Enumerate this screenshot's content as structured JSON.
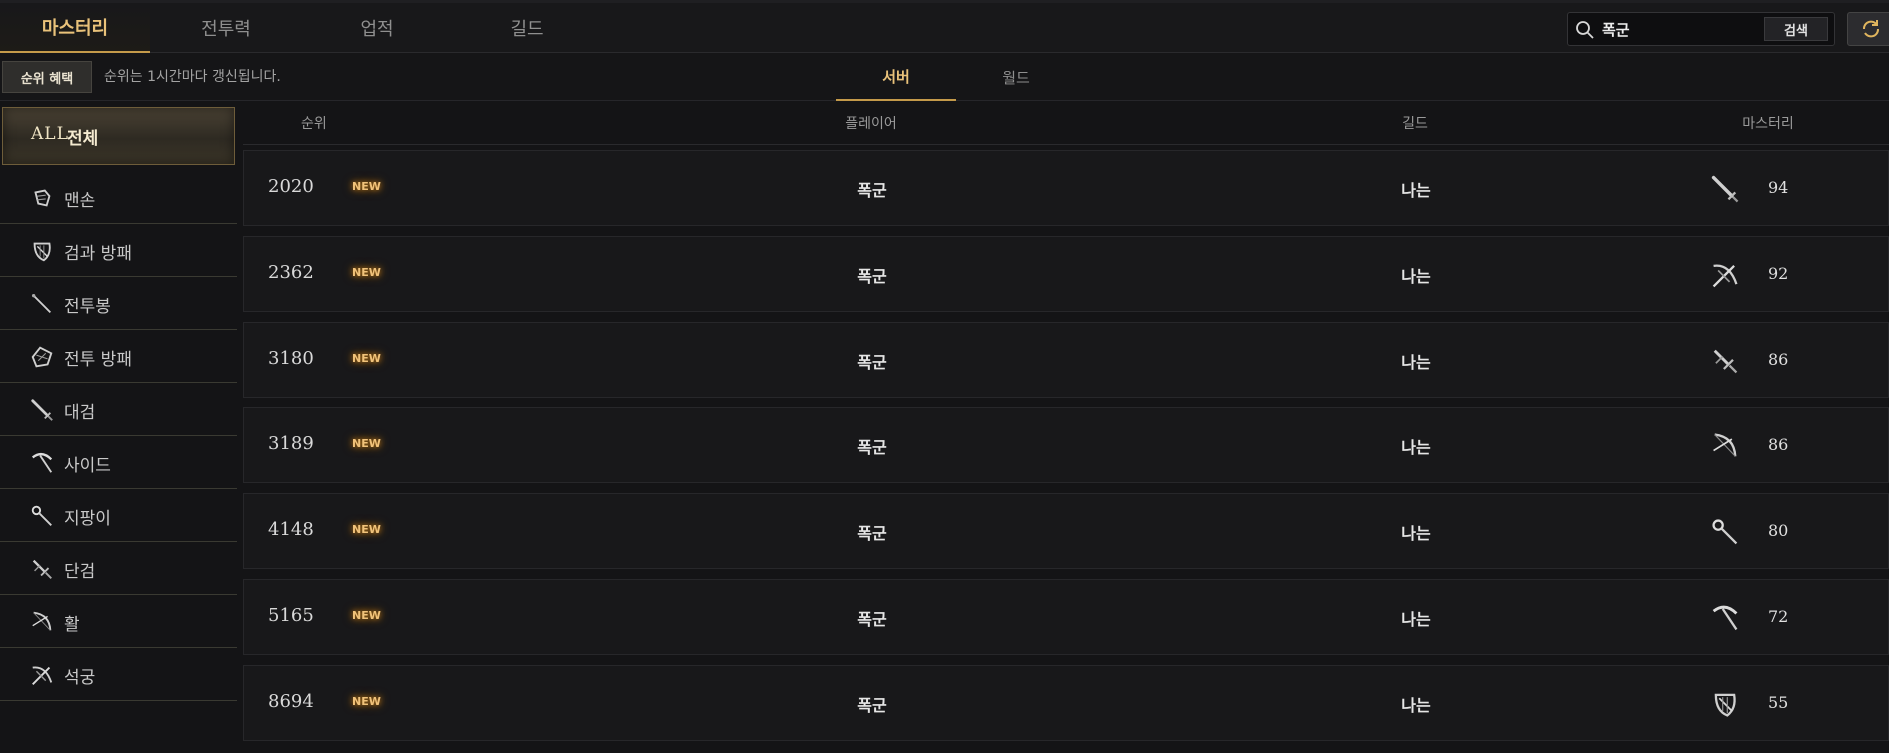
{
  "top_tabs": [
    {
      "label": "마스터리",
      "active": true
    },
    {
      "label": "전투력",
      "active": false
    },
    {
      "label": "업적",
      "active": false
    },
    {
      "label": "길드",
      "active": false
    }
  ],
  "search": {
    "value": "폭군",
    "button_label": "검색"
  },
  "subbar": {
    "benefit_label": "순위 혜택",
    "notice": "순위는 1시간마다 갱신됩니다.",
    "tabs": [
      {
        "label": "서버",
        "active": true
      },
      {
        "label": "월드",
        "active": false
      }
    ]
  },
  "sidebar": {
    "all_prefix": "ALL",
    "items": [
      {
        "label": "전체",
        "icon": "all-icon",
        "active": true
      },
      {
        "label": "맨손",
        "icon": "fist-icon"
      },
      {
        "label": "검과 방패",
        "icon": "sword-shield-icon"
      },
      {
        "label": "전투봉",
        "icon": "battle-staff-icon"
      },
      {
        "label": "전투 방패",
        "icon": "battle-shield-icon"
      },
      {
        "label": "대검",
        "icon": "greatsword-icon"
      },
      {
        "label": "사이드",
        "icon": "scythe-icon"
      },
      {
        "label": "지팡이",
        "icon": "wand-icon"
      },
      {
        "label": "단검",
        "icon": "dagger-icon"
      },
      {
        "label": "활",
        "icon": "bow-icon"
      },
      {
        "label": "석궁",
        "icon": "crossbow-icon"
      }
    ]
  },
  "table": {
    "headers": {
      "rank": "순위",
      "player": "플레이어",
      "guild": "길드",
      "mastery": "마스터리"
    },
    "rows": [
      {
        "rank": "2020",
        "badge": "NEW",
        "player": "폭군",
        "guild": "나는",
        "weapon_icon": "greatsword-icon",
        "mastery": "94"
      },
      {
        "rank": "2362",
        "badge": "NEW",
        "player": "폭군",
        "guild": "나는",
        "weapon_icon": "crossbow-icon",
        "mastery": "92"
      },
      {
        "rank": "3180",
        "badge": "NEW",
        "player": "폭군",
        "guild": "나는",
        "weapon_icon": "dagger-icon",
        "mastery": "86"
      },
      {
        "rank": "3189",
        "badge": "NEW",
        "player": "폭군",
        "guild": "나는",
        "weapon_icon": "bow-icon",
        "mastery": "86"
      },
      {
        "rank": "4148",
        "badge": "NEW",
        "player": "폭군",
        "guild": "나는",
        "weapon_icon": "wand-icon",
        "mastery": "80"
      },
      {
        "rank": "5165",
        "badge": "NEW",
        "player": "폭군",
        "guild": "나는",
        "weapon_icon": "scythe-icon",
        "mastery": "72"
      },
      {
        "rank": "8694",
        "badge": "NEW",
        "player": "폭군",
        "guild": "나는",
        "weapon_icon": "sword-shield-icon",
        "mastery": "55"
      }
    ]
  },
  "colors": {
    "accent": "#e9c27a",
    "badge_glow": "#c7801a",
    "background": "#141416"
  }
}
